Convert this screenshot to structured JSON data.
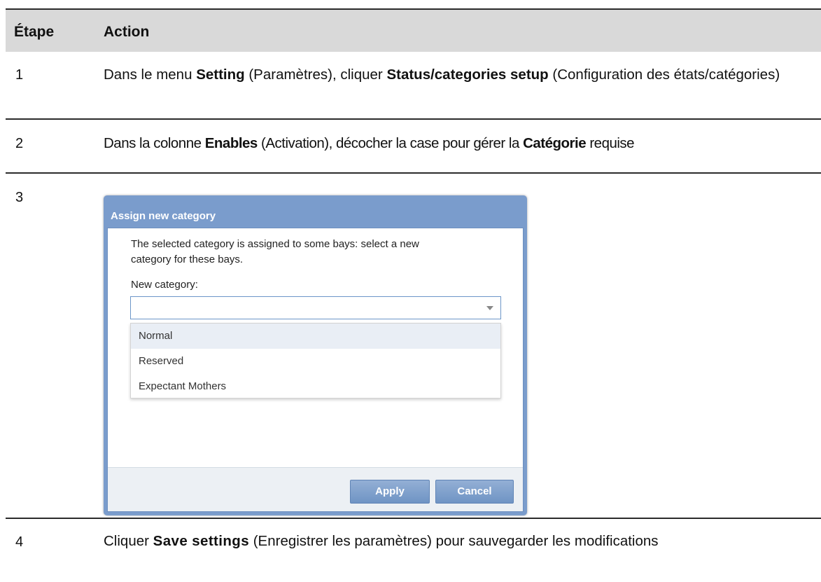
{
  "table": {
    "headers": [
      "Étape",
      "Action"
    ],
    "rows": [
      {
        "num": "1",
        "parts": [
          "Dans le menu ",
          "Setting",
          " (Paramètres), cliquer ",
          "Status/categories setup",
          " (Configuration des états/catégories)"
        ]
      },
      {
        "num": "2",
        "parts": [
          "Dans la colonne ",
          "Enables",
          " (Activation), décocher la case pour gérer la ",
          "Catégorie",
          " requise"
        ]
      },
      {
        "num": "3"
      },
      {
        "num": "4",
        "parts": [
          "Cliquer ",
          "Save settings",
          " (Enregistrer les paramètres) pour sauvegarder les modifications"
        ]
      }
    ]
  },
  "dialog": {
    "title": "Assign new category",
    "message": "The selected category is assigned to some bays: select a new category for these bays.",
    "field_label": "New category:",
    "select_value": "",
    "options": [
      "Normal",
      "Reserved",
      "Expectant Mothers"
    ],
    "highlighted_option": "Normal",
    "apply_label": "Apply",
    "cancel_label": "Cancel"
  },
  "colors": {
    "header_bg": "#d9d9d9",
    "dialog_frame": "#7a9ccc",
    "button": "#7f9fcb",
    "option_highlight": "#e9eef5"
  }
}
